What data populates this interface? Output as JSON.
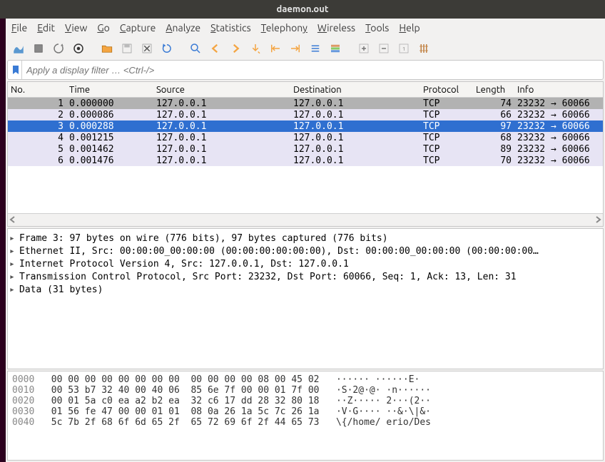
{
  "window": {
    "title": "daemon.out"
  },
  "menu": {
    "file": "File",
    "edit": "Edit",
    "view": "View",
    "go": "Go",
    "capture": "Capture",
    "analyze": "Analyze",
    "statistics": "Statistics",
    "telephony": "Telephony",
    "wireless": "Wireless",
    "tools": "Tools",
    "help": "Help"
  },
  "filter": {
    "placeholder": "Apply a display filter … <Ctrl-/>"
  },
  "columns": {
    "no": "No.",
    "time": "Time",
    "src": "Source",
    "dst": "Destination",
    "proto": "Protocol",
    "len": "Length",
    "info": "Info"
  },
  "packets": [
    {
      "no": "1",
      "time": "0.000000",
      "src": "127.0.0.1",
      "dst": "127.0.0.1",
      "proto": "TCP",
      "len": "74",
      "info": "23232 → 60066"
    },
    {
      "no": "2",
      "time": "0.000086",
      "src": "127.0.0.1",
      "dst": "127.0.0.1",
      "proto": "TCP",
      "len": "66",
      "info": "23232 → 60066"
    },
    {
      "no": "3",
      "time": "0.000288",
      "src": "127.0.0.1",
      "dst": "127.0.0.1",
      "proto": "TCP",
      "len": "97",
      "info": "23232 → 60066"
    },
    {
      "no": "4",
      "time": "0.001215",
      "src": "127.0.0.1",
      "dst": "127.0.0.1",
      "proto": "TCP",
      "len": "68",
      "info": "23232 → 60066"
    },
    {
      "no": "5",
      "time": "0.001462",
      "src": "127.0.0.1",
      "dst": "127.0.0.1",
      "proto": "TCP",
      "len": "89",
      "info": "23232 → 60066"
    },
    {
      "no": "6",
      "time": "0.001476",
      "src": "127.0.0.1",
      "dst": "127.0.0.1",
      "proto": "TCP",
      "len": "70",
      "info": "23232 → 60066"
    }
  ],
  "selected_index": 2,
  "details": [
    "Frame 3: 97 bytes on wire (776 bits), 97 bytes captured (776 bits)",
    "Ethernet II, Src: 00:00:00_00:00:00 (00:00:00:00:00:00), Dst: 00:00:00_00:00:00 (00:00:00:00…",
    "Internet Protocol Version 4, Src: 127.0.0.1, Dst: 127.0.0.1",
    "Transmission Control Protocol, Src Port: 23232, Dst Port: 60066, Seq: 1, Ack: 13, Len: 31",
    "Data (31 bytes)"
  ],
  "hex": [
    {
      "off": "0000",
      "bytes": "00 00 00 00 00 00 00 00  00 00 00 00 08 00 45 02",
      "ascii": "······ ······E·"
    },
    {
      "off": "0010",
      "bytes": "00 53 b7 32 40 00 40 06  85 6e 7f 00 00 01 7f 00",
      "ascii": "·S·2@·@· ·n······"
    },
    {
      "off": "0020",
      "bytes": "00 01 5a c0 ea a2 b2 ea  32 c6 17 dd 28 32 80 18",
      "ascii": "··Z····· 2···(2··"
    },
    {
      "off": "0030",
      "bytes": "01 56 fe 47 00 00 01 01  08 0a 26 1a 5c 7c 26 1a",
      "ascii": "·V·G···· ··&·\\|&·"
    },
    {
      "off": "0040",
      "bytes": "5c 7b 2f 68 6f 6d 65 2f  65 72 69 6f 2f 44 65 73",
      "ascii": "\\{/home/ erio/Des"
    }
  ]
}
